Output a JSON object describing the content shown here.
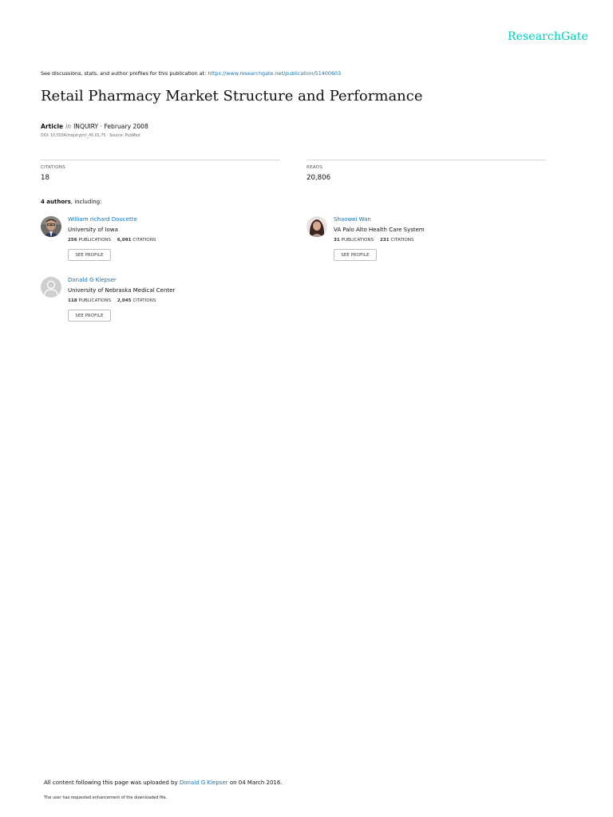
{
  "brand": {
    "name": "ResearchGate",
    "color": "#00ccbb"
  },
  "discussion": {
    "prefix": "See discussions, stats, and author profiles for this publication at: ",
    "url": "https://www.researchgate.net/publication/51400603"
  },
  "article": {
    "title": "Retail Pharmacy Market Structure and Performance",
    "type": "Article",
    "in": "in",
    "venue_date": "INQUIRY · February 2008",
    "doi_source": "DOI: 10.5034/inquiryjrnl_45.01.75 · Source: PubMed"
  },
  "stats": {
    "citations_label": "CITATIONS",
    "citations_value": "18",
    "reads_label": "READS",
    "reads_value": "20,806"
  },
  "authors_heading": {
    "count": "4 authors",
    "suffix": ", including:"
  },
  "authors": [
    {
      "name": "William richard Doucette",
      "institution": "University of Iowa",
      "publications": "256",
      "publications_label": "PUBLICATIONS",
      "citations": "6,091",
      "citations_label": "CITATIONS",
      "button": "SEE PROFILE",
      "avatar_icon": "person-photo"
    },
    {
      "name": "Shaowei Wan",
      "institution": "VA Palo Alto Health Care System",
      "publications": "31",
      "publications_label": "PUBLICATIONS",
      "citations": "231",
      "citations_label": "CITATIONS",
      "button": "SEE PROFILE",
      "avatar_icon": "person-photo"
    },
    {
      "name": "Donald G Klepser",
      "institution": "University of Nebraska Medical Center",
      "publications": "118",
      "publications_label": "PUBLICATIONS",
      "citations": "2,045",
      "citations_label": "CITATIONS",
      "button": "SEE PROFILE",
      "avatar_icon": "default-avatar-icon"
    }
  ],
  "footer": {
    "uploaded_prefix": "All content following this page was uploaded by ",
    "uploader": "Donald G Klepser",
    "uploaded_suffix": " on 04 March 2016.",
    "note": "The user has requested enhancement of the downloaded file."
  }
}
